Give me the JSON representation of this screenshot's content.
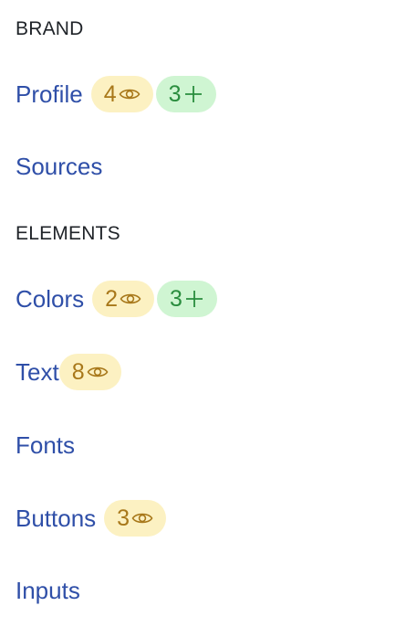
{
  "sections": {
    "brand": {
      "heading": "BRAND",
      "items": {
        "profile": {
          "label": "Profile",
          "views": "4",
          "adds": "3"
        },
        "sources": {
          "label": "Sources"
        }
      }
    },
    "elements": {
      "heading": "ELEMENTS",
      "items": {
        "colors": {
          "label": "Colors",
          "views": "2",
          "adds": "3"
        },
        "text": {
          "label": "Text",
          "views": "8"
        },
        "fonts": {
          "label": "Fonts"
        },
        "buttons": {
          "label": "Buttons",
          "views": "3"
        },
        "inputs": {
          "label": "Inputs"
        }
      }
    }
  },
  "icons": {
    "views": "eye-icon",
    "adds": "plus-icon"
  },
  "colors": {
    "link": "#2f4fa8",
    "heading": "#1f2328",
    "views_badge_bg": "#fcf1c2",
    "views_badge_fg": "#a8781a",
    "adds_badge_bg": "#cff5d2",
    "adds_badge_fg": "#2a8d3e"
  }
}
